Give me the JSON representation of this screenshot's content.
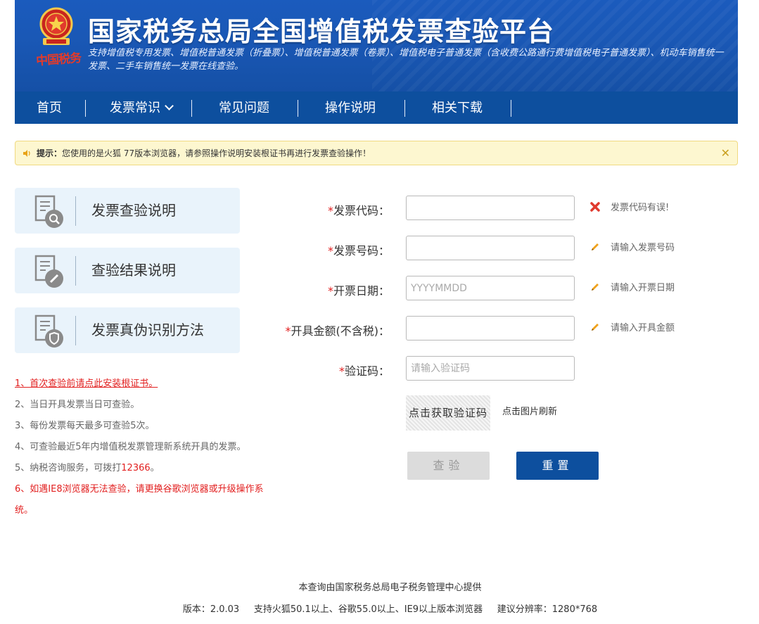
{
  "header": {
    "title": "国家税务总局全国增值税发票查验平台",
    "subtitle": "支持增值税专用发票、增值税普通发票（折叠票）、增值税普通发票（卷票）、增值税电子普通发票（含收费公路通行费增值税电子普通发票）、机动车销售统一发票、二手车销售统一发票在线查验。",
    "seal_text": "中国税务"
  },
  "nav": {
    "items": [
      {
        "label": "首页"
      },
      {
        "label": "发票常识"
      },
      {
        "label": "常见问题"
      },
      {
        "label": "操作说明"
      },
      {
        "label": "相关下载"
      }
    ]
  },
  "notice": {
    "prefix": "提示：",
    "text": "您使用的是火狐 77版本浏览器，请参照操作说明安装根证书再进行发票查验操作！",
    "close": "✕"
  },
  "sidebar": {
    "cards": [
      {
        "label": "发票查验说明",
        "icon": "search-doc-icon"
      },
      {
        "label": "查验结果说明",
        "icon": "edit-doc-icon"
      },
      {
        "label": "发票真伪识别方法",
        "icon": "shield-doc-icon"
      }
    ],
    "tips": {
      "t1": "1、首次查验前请点此安装根证书。",
      "t2": "2、当日开具发票当日可查验。",
      "t3": "3、每份发票每天最多可查验5次。",
      "t4": "4、可查验最近5年内增值税发票管理新系统开具的发票。",
      "t5_prefix": "5、纳税咨询服务，可拨打",
      "t5_phone": "12366",
      "t5_suffix": "。",
      "t6": "6、如遇IE8浏览器无法查验，请更换谷歌浏览器或升级操作系统。"
    }
  },
  "form": {
    "required_mark": "*",
    "fields": [
      {
        "label": "发票代码：",
        "value": "",
        "placeholder": "",
        "hint": "发票代码有误!",
        "hint_icon": "error-x-icon"
      },
      {
        "label": "发票号码：",
        "value": "",
        "placeholder": "",
        "hint": "请输入发票号码",
        "hint_icon": "pencil-icon"
      },
      {
        "label": "开票日期：",
        "value": "",
        "placeholder": "YYYYMMDD",
        "hint": "请输入开票日期",
        "hint_icon": "pencil-icon"
      },
      {
        "label": "开具金额(不含税)：",
        "value": "",
        "placeholder": "",
        "hint": "请输入开具金额",
        "hint_icon": "pencil-icon"
      },
      {
        "label": "验证码：",
        "value": "",
        "placeholder": "请输入验证码",
        "hint": "",
        "hint_icon": ""
      }
    ],
    "captcha_text": "点击获取验证码",
    "refresh_text": "点击图片刷新",
    "check_button": "查验",
    "reset_button": "重置"
  },
  "footer": {
    "provider": "本查询由国家税务总局电子税务管理中心提供",
    "version": "版本：2.0.03",
    "support": "支持火狐50.1以上、谷歌55.0以上、IE9以上版本浏览器",
    "resolution": "建议分辨率：1280*768"
  },
  "colors": {
    "header_blue": "#1a58b6",
    "nav_blue": "#0d4f9e",
    "notice_bg": "#fdf7d0",
    "card_bg": "#e9f3fb",
    "red": "#e22020"
  }
}
